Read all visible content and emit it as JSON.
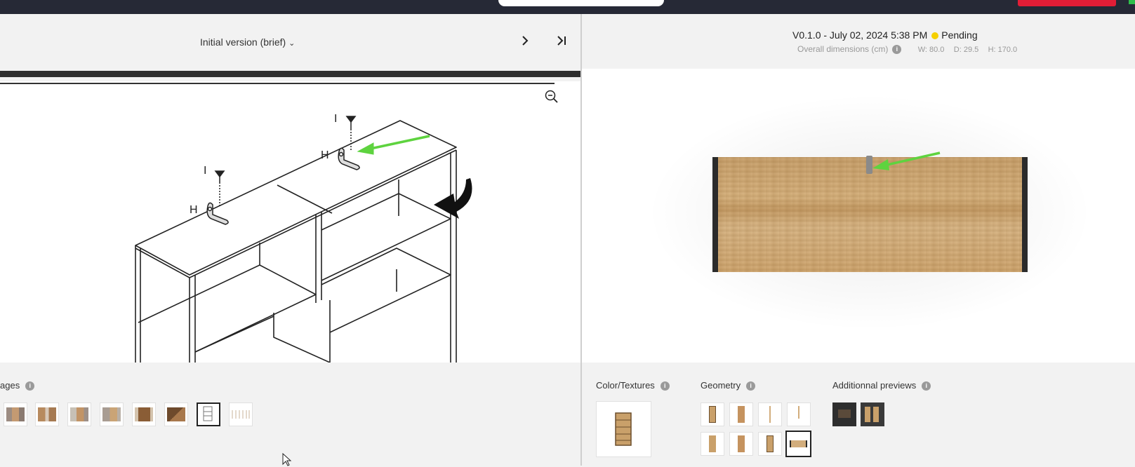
{
  "left": {
    "version_label": "Initial version (brief)",
    "images_label": "ages",
    "image_thumbs": [
      "photo-1",
      "photo-2",
      "photo-3",
      "photo-4",
      "photo-5",
      "photo-6",
      "assembly-drawing-selected",
      "assembly-sheet"
    ]
  },
  "drawing": {
    "letter_i": "I",
    "letter_h": "H"
  },
  "right": {
    "version_text": "V0.1.0 - July 02, 2024 5:38 PM",
    "status": "Pending",
    "status_color": "#f5d000",
    "dims_label": "Overall dimensions (cm)",
    "dim_w": "W: 80.0",
    "dim_d": "D: 29.5",
    "dim_h": "H: 170.0",
    "color_label": "Color/Textures",
    "geometry_label": "Geometry",
    "additional_label": "Additionnal previews"
  },
  "colors": {
    "arrow": "#5ed33f",
    "topbar": "#262936",
    "accent_red": "#e21d36"
  }
}
